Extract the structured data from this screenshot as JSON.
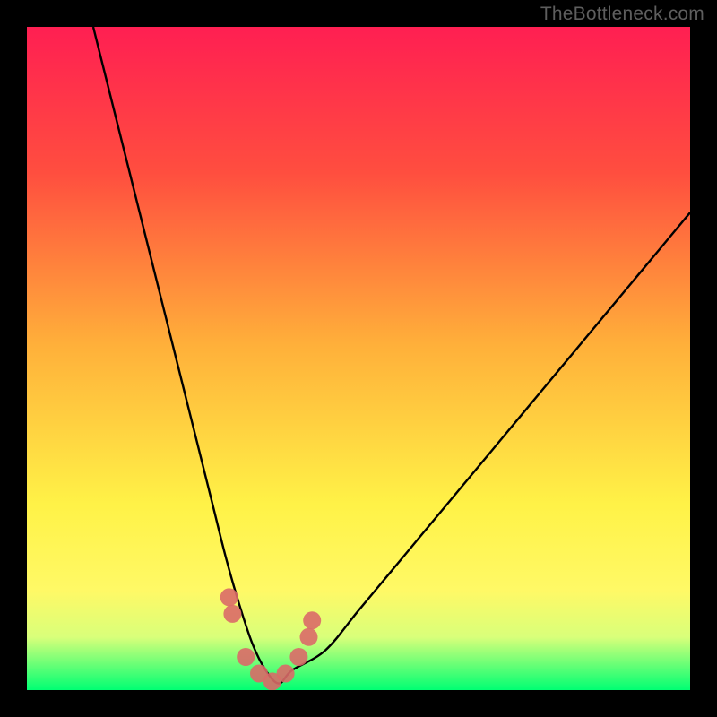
{
  "watermark": {
    "text": "TheBottleneck.com"
  },
  "colors": {
    "top": "#ff1f52",
    "mid1": "#ff4e3f",
    "mid2": "#ffb03a",
    "mid3": "#fff247",
    "band_yellow": "#fff966",
    "band_light": "#d9ff7a",
    "green": "#00ff73",
    "curve": "#000000",
    "marker": "#da6a68"
  },
  "chart_data": {
    "type": "line",
    "title": "",
    "xlabel": "",
    "ylabel": "",
    "xlim": [
      0,
      100
    ],
    "ylim": [
      0,
      100
    ],
    "series": [
      {
        "name": "bottleneck-curve",
        "x": [
          10,
          12,
          14,
          16,
          18,
          20,
          22,
          24,
          26,
          28,
          30,
          32,
          34,
          36,
          38,
          40,
          45,
          50,
          55,
          60,
          65,
          70,
          75,
          80,
          85,
          90,
          95,
          100
        ],
        "y": [
          100,
          92,
          84,
          76,
          68,
          60,
          52,
          44,
          36,
          28,
          20,
          13,
          7,
          3,
          1,
          3,
          6,
          12,
          18,
          24,
          30,
          36,
          42,
          48,
          54,
          60,
          66,
          72
        ]
      }
    ],
    "markers": {
      "name": "highlight-points",
      "x": [
        30.5,
        31.0,
        33.0,
        35.0,
        37.0,
        39.0,
        41.0,
        42.5,
        43.0
      ],
      "y": [
        14.0,
        11.5,
        5.0,
        2.5,
        1.3,
        2.5,
        5.0,
        8.0,
        10.5
      ]
    },
    "gradient_stops": [
      {
        "pct": 0,
        "hex": "#ff1f52"
      },
      {
        "pct": 22,
        "hex": "#ff4e3f"
      },
      {
        "pct": 48,
        "hex": "#ffb03a"
      },
      {
        "pct": 72,
        "hex": "#fff247"
      },
      {
        "pct": 85,
        "hex": "#fff966"
      },
      {
        "pct": 92,
        "hex": "#d9ff7a"
      },
      {
        "pct": 100,
        "hex": "#00ff73"
      }
    ]
  }
}
